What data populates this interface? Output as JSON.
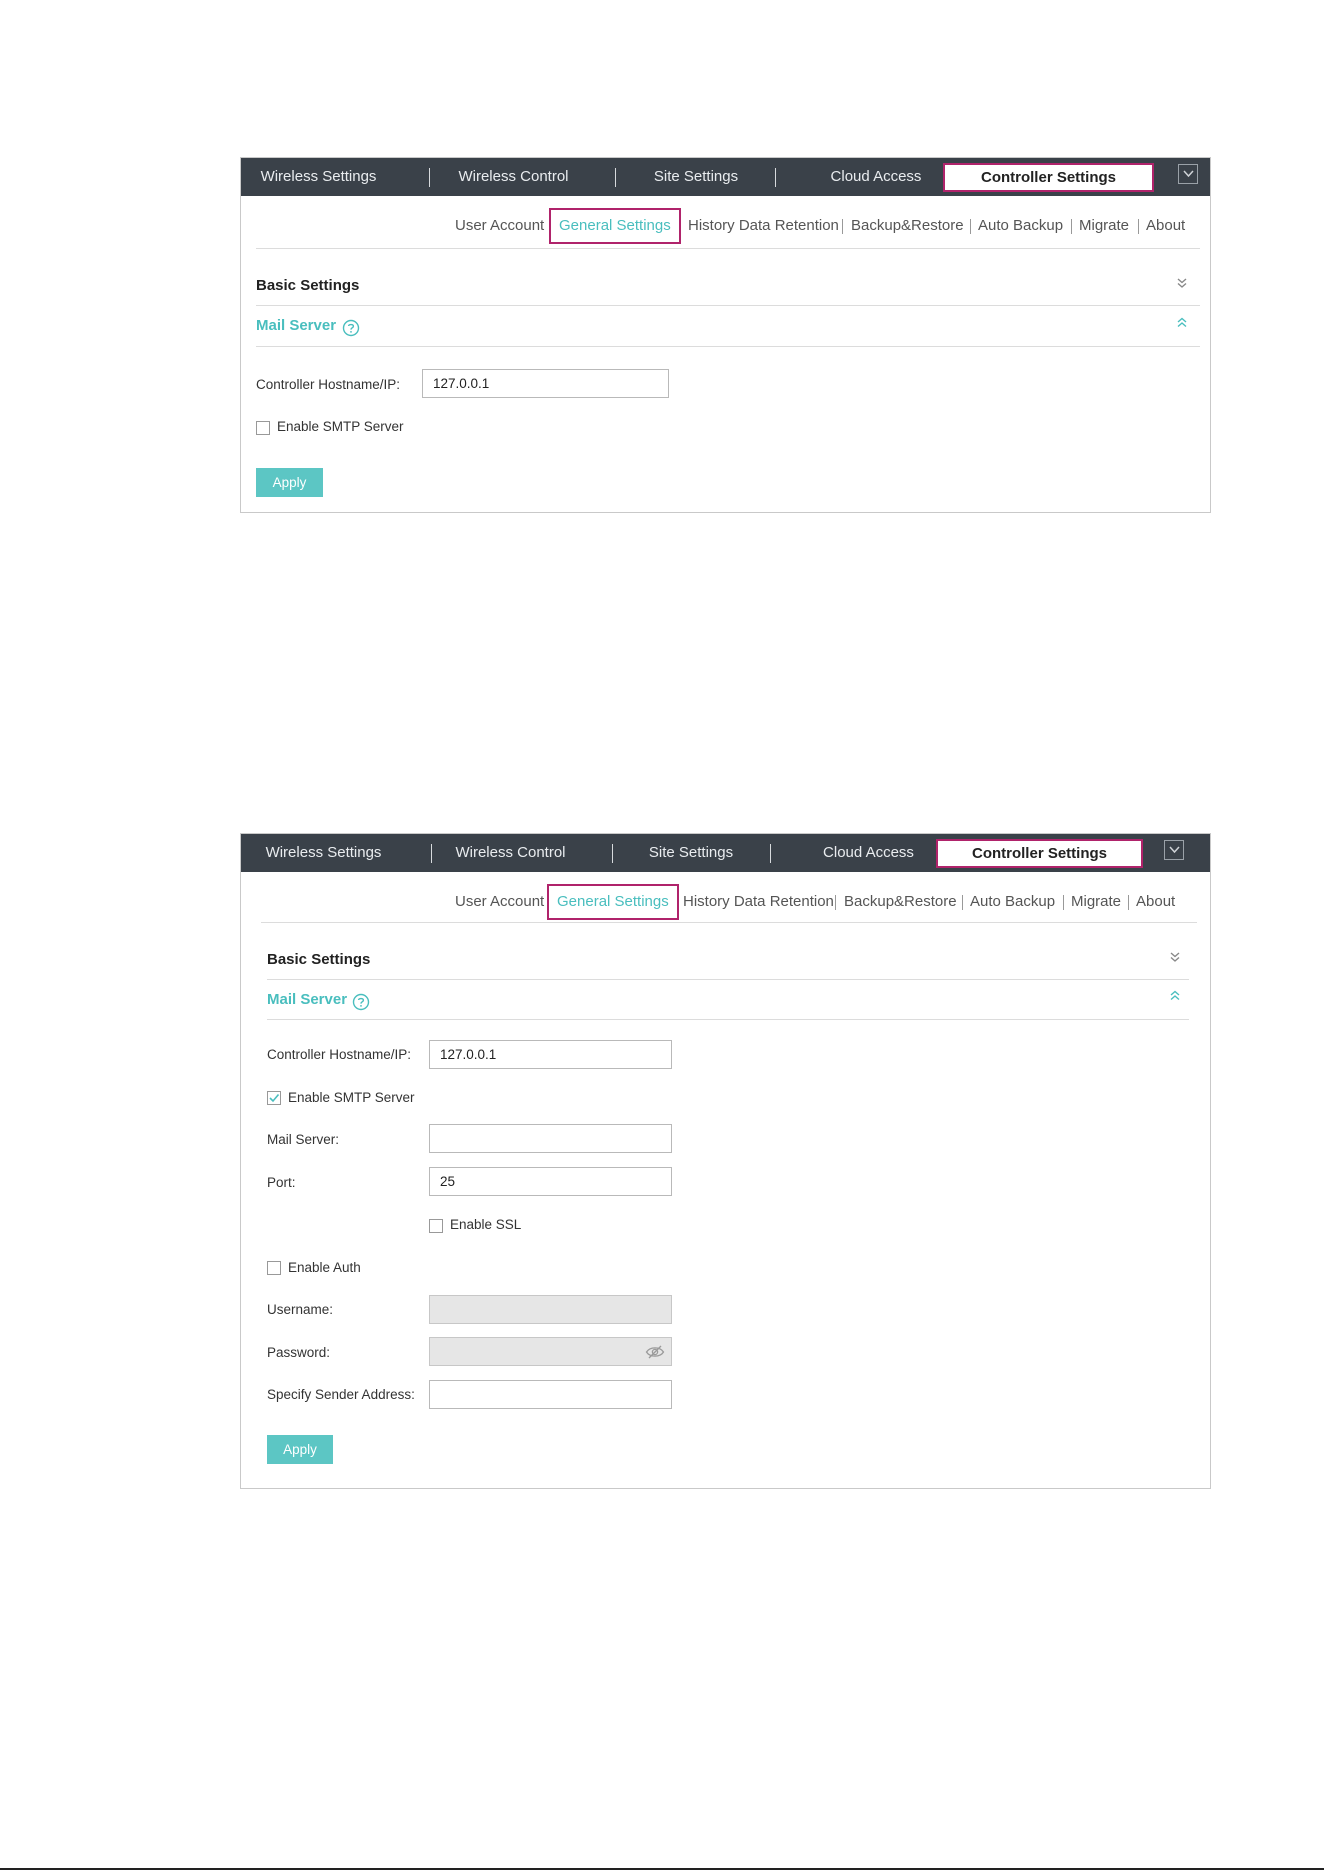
{
  "top_nav": {
    "tabs": [
      "Wireless Settings",
      "Wireless Control",
      "Site Settings",
      "Cloud Access",
      "Controller Settings"
    ],
    "active": "Controller Settings"
  },
  "sub_nav": {
    "items": [
      "User Account",
      "General Settings",
      "History Data Retention",
      "Backup&Restore",
      "Auto Backup",
      "Migrate",
      "About"
    ],
    "active": "General Settings"
  },
  "sections": {
    "basic_settings": "Basic Settings",
    "mail_server": "Mail Server"
  },
  "screen1": {
    "hostname_label": "Controller Hostname/IP:",
    "hostname_value": "127.0.0.1",
    "smtp_label": "Enable SMTP Server",
    "smtp_checked": false,
    "apply_label": "Apply"
  },
  "screen2": {
    "hostname_label": "Controller Hostname/IP:",
    "hostname_value": "127.0.0.1",
    "smtp_label": "Enable SMTP Server",
    "smtp_checked": true,
    "mail_server_label": "Mail Server:",
    "mail_server_value": "",
    "port_label": "Port:",
    "port_value": "25",
    "ssl_label": "Enable SSL",
    "ssl_checked": false,
    "auth_label": "Enable Auth",
    "auth_checked": false,
    "username_label": "Username:",
    "username_value": "",
    "password_label": "Password:",
    "password_value": "",
    "sender_label": "Specify Sender Address:",
    "sender_value": "",
    "apply_label": "Apply"
  },
  "colors": {
    "nav_bg": "#3a4149",
    "accent_teal": "#49bebe",
    "button_teal": "#5cc6c4",
    "highlight_magenta": "#b0236b"
  },
  "icons": [
    "chevron-down-icon",
    "question-circle-icon",
    "double-chevron-down-icon",
    "double-chevron-up-icon",
    "check-icon",
    "eye-off-icon"
  ]
}
